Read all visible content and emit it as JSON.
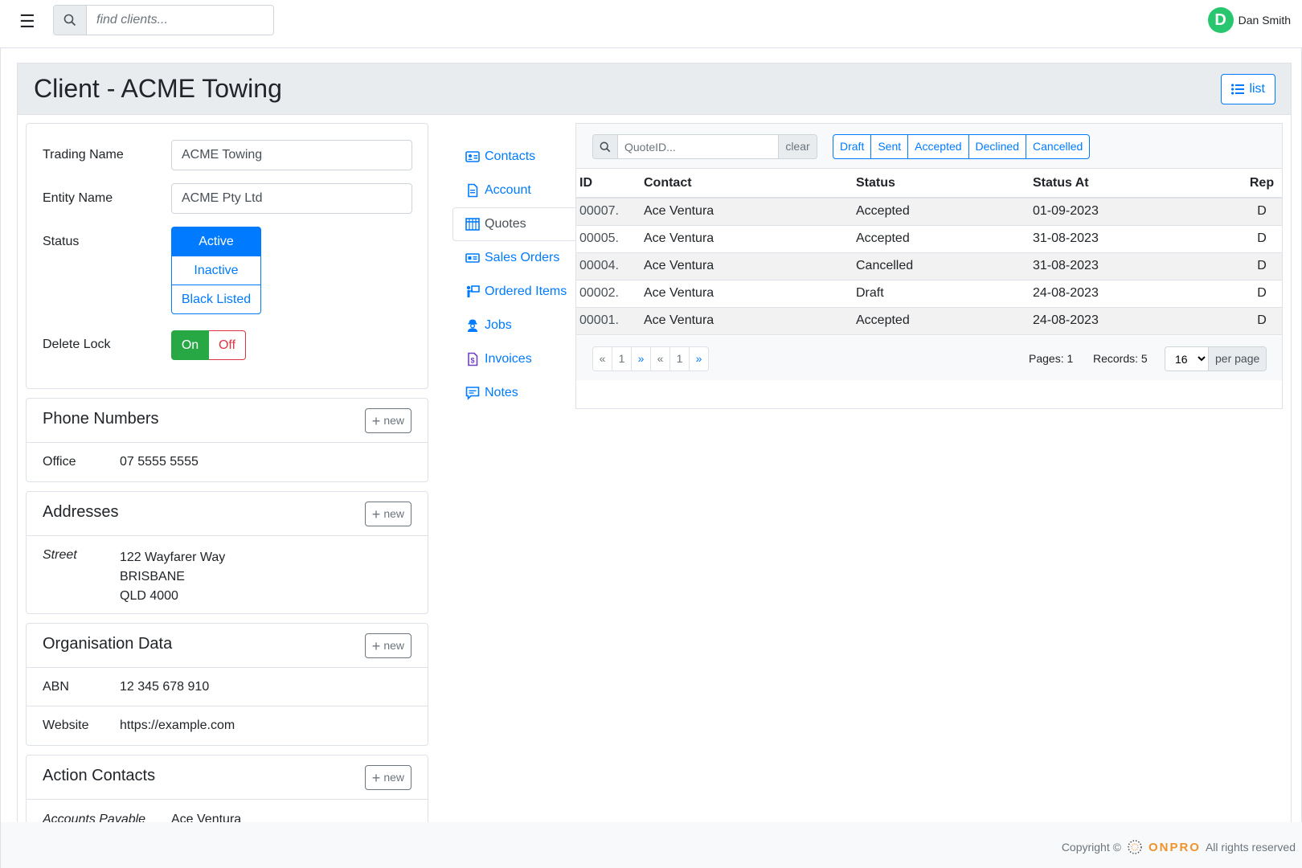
{
  "header": {
    "search_placeholder": "find clients...",
    "user_initial": "D",
    "user_name": "Dan Smith"
  },
  "page": {
    "title": "Client - ACME Towing",
    "list_label": "list"
  },
  "form": {
    "trading_name_label": "Trading Name",
    "trading_name_value": "ACME Towing",
    "entity_name_label": "Entity Name",
    "entity_name_value": "ACME Pty Ltd",
    "status_label": "Status",
    "status_options": [
      "Active",
      "Inactive",
      "Black Listed"
    ],
    "status_selected": "Active",
    "delete_lock_label": "Delete Lock",
    "delete_lock_on": "On",
    "delete_lock_off": "Off"
  },
  "phones": {
    "title": "Phone Numbers",
    "new_label": "new",
    "items": [
      {
        "label": "Office",
        "value": "07 5555 5555"
      }
    ]
  },
  "addresses": {
    "title": "Addresses",
    "new_label": "new",
    "items": [
      {
        "label": "Street",
        "lines": [
          "122 Wayfarer Way",
          "BRISBANE",
          "QLD 4000"
        ]
      }
    ]
  },
  "organisation": {
    "title": "Organisation Data",
    "new_label": "new",
    "items": [
      {
        "label": "ABN",
        "value": "12 345 678 910"
      },
      {
        "label": "Website",
        "value": "https://example.com"
      }
    ]
  },
  "action_contacts": {
    "title": "Action Contacts",
    "new_label": "new",
    "items": [
      {
        "label": "Accounts Payable",
        "value": "Ace Ventura"
      }
    ]
  },
  "tabs": [
    {
      "label": "Contacts",
      "icon": "contact-card-icon"
    },
    {
      "label": "Account",
      "icon": "document-icon"
    },
    {
      "label": "Quotes",
      "icon": "table-icon",
      "active": true
    },
    {
      "label": "Sales Orders",
      "icon": "money-icon"
    },
    {
      "label": "Ordered Items",
      "icon": "person-board-icon"
    },
    {
      "label": "Jobs",
      "icon": "worker-icon"
    },
    {
      "label": "Invoices",
      "icon": "invoice-icon"
    },
    {
      "label": "Notes",
      "icon": "comment-icon"
    }
  ],
  "quotes": {
    "search_placeholder": "QuoteID...",
    "clear_label": "clear",
    "filters": [
      "Draft",
      "Sent",
      "Accepted",
      "Declined",
      "Cancelled"
    ],
    "columns": [
      "ID",
      "Contact",
      "Status",
      "Status At",
      "Rep"
    ],
    "rows": [
      {
        "id": "00007.",
        "contact": "Ace Ventura",
        "status": "Accepted",
        "status_at": "01-09-2023",
        "rep": "D"
      },
      {
        "id": "00005.",
        "contact": "Ace Ventura",
        "status": "Accepted",
        "status_at": "31-08-2023",
        "rep": "D"
      },
      {
        "id": "00004.",
        "contact": "Ace Ventura",
        "status": "Cancelled",
        "status_at": "31-08-2023",
        "rep": "D"
      },
      {
        "id": "00002.",
        "contact": "Ace Ventura",
        "status": "Draft",
        "status_at": "24-08-2023",
        "rep": "D"
      },
      {
        "id": "00001.",
        "contact": "Ace Ventura",
        "status": "Accepted",
        "status_at": "24-08-2023",
        "rep": "D"
      }
    ],
    "pager": [
      "«",
      "1",
      "»",
      "«",
      "1",
      "»"
    ],
    "pages_text": "Pages: 1",
    "records_text": "Records: 5",
    "per_page_value": "16",
    "per_page_label": "per page"
  },
  "footer": {
    "copyright": "Copyright ©",
    "brand": "ONPRO",
    "rights": "All rights reserved"
  },
  "colors": {
    "primary": "#007bff",
    "success": "#28a745",
    "danger": "#dc3545",
    "avatar": "#28c76f",
    "brand": "#f0932b"
  }
}
